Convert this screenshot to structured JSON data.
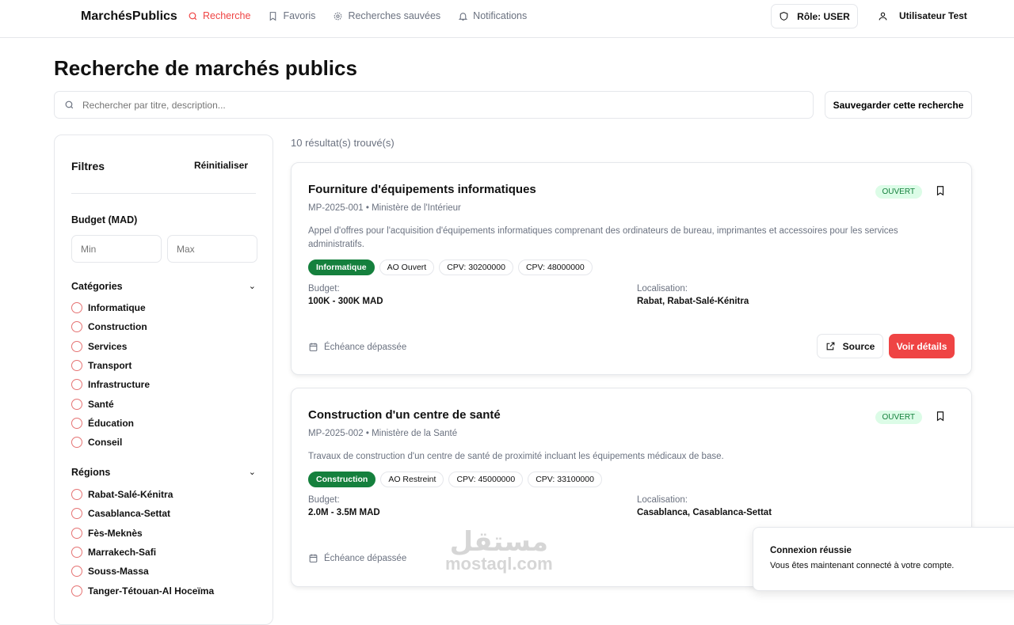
{
  "header": {
    "logo": "MarchésPublics",
    "nav": [
      {
        "label": "Recherche",
        "icon": "search-icon",
        "active": true
      },
      {
        "label": "Favoris",
        "icon": "bookmark-icon"
      },
      {
        "label": "Recherches sauvées",
        "icon": "gear-icon"
      },
      {
        "label": "Notifications",
        "icon": "bell-icon"
      }
    ],
    "role": "Rôle: USER",
    "user": "Utilisateur Test"
  },
  "page": {
    "title": "Recherche de marchés publics",
    "search_placeholder": "Rechercher par titre, description...",
    "save_search": "Sauvegarder cette recherche",
    "results_count": "10 résultat(s) trouvé(s)"
  },
  "filters": {
    "title": "Filtres",
    "reset": "Réinitialiser",
    "budget_label": "Budget (MAD)",
    "min_placeholder": "Min",
    "max_placeholder": "Max",
    "categories_label": "Catégories",
    "categories": [
      "Informatique",
      "Construction",
      "Services",
      "Transport",
      "Infrastructure",
      "Santé",
      "Éducation",
      "Conseil"
    ],
    "regions_label": "Régions",
    "regions": [
      "Rabat-Salé-Kénitra",
      "Casablanca-Settat",
      "Fès-Meknès",
      "Marrakech-Safi",
      "Souss-Massa",
      "Tanger-Tétouan-Al Hoceïma"
    ]
  },
  "results": [
    {
      "title": "Fourniture d'équipements informatiques",
      "meta": "MP-2025-001 • Ministère de l'Intérieur",
      "status": "OUVERT",
      "description": "Appel d'offres pour l'acquisition d'équipements informatiques comprenant des ordinateurs de bureau, imprimantes et accessoires pour les services administratifs.",
      "tags": [
        "Informatique",
        "AO Ouvert",
        "CPV: 30200000",
        "CPV: 48000000"
      ],
      "budget_label": "Budget:",
      "budget": "100K - 300K MAD",
      "location_label": "Localisation:",
      "location": "Rabat, Rabat-Salé-Kénitra",
      "deadline": "Échéance dépassée",
      "source": "Source",
      "details": "Voir détails"
    },
    {
      "title": "Construction d'un centre de santé",
      "meta": "MP-2025-002 • Ministère de la Santé",
      "status": "OUVERT",
      "description": "Travaux de construction d'un centre de santé de proximité incluant les équipements médicaux de base.",
      "tags": [
        "Construction",
        "AO Restreint",
        "CPV: 45000000",
        "CPV: 33100000"
      ],
      "budget_label": "Budget:",
      "budget": "2.0M - 3.5M MAD",
      "location_label": "Localisation:",
      "location": "Casablanca, Casablanca-Settat",
      "deadline": "Échéance dépassée"
    }
  ],
  "toast": {
    "title": "Connexion réussie",
    "message": "Vous êtes maintenant connecté à votre compte."
  },
  "watermark": {
    "arabic": "مستقل",
    "latin": "mostaql.com"
  },
  "colors": {
    "accent": "#ef4444",
    "green": "#15803d"
  }
}
